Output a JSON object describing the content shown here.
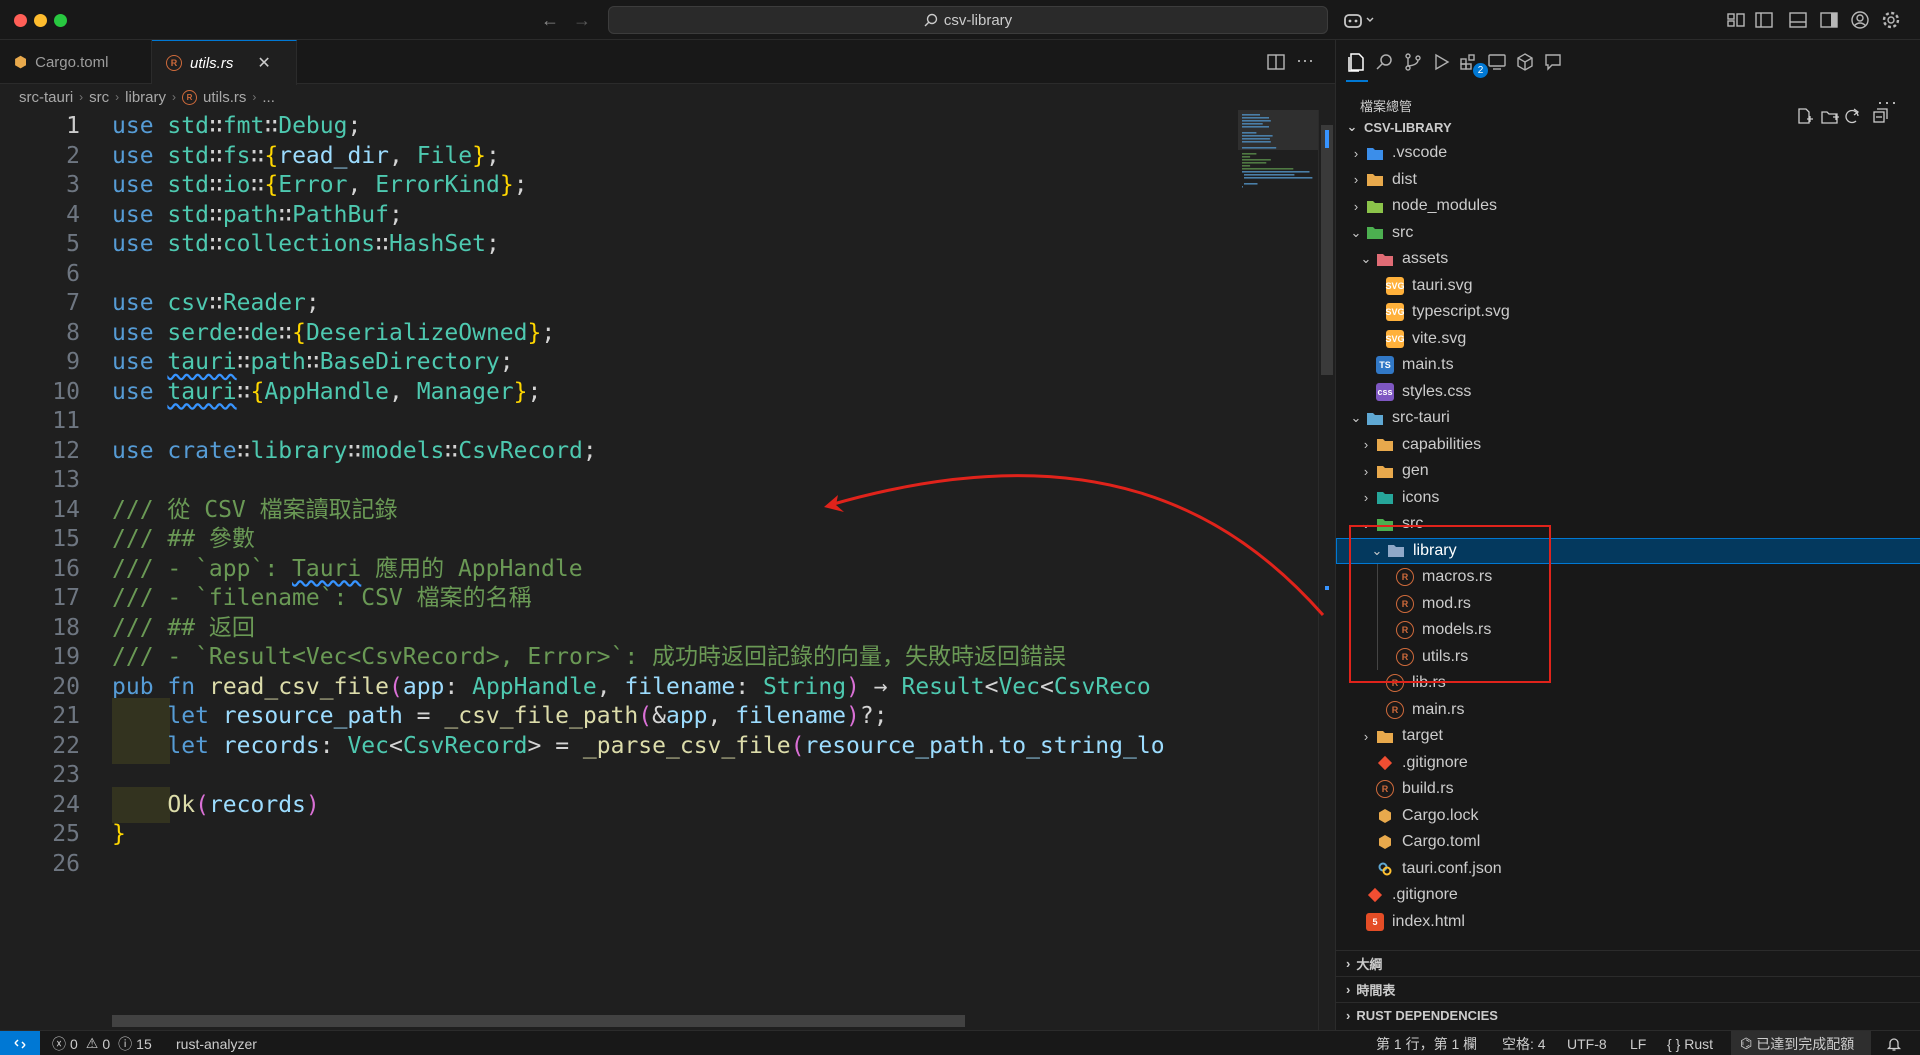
{
  "window": {
    "search_text": "csv-library"
  },
  "tabs": [
    {
      "label": "Cargo.toml",
      "icon": "rust-cargo-icon"
    },
    {
      "label": "utils.rs",
      "icon": "rust-file-icon",
      "active": true
    }
  ],
  "breadcrumb": [
    "src-tauri",
    "src",
    "library",
    "utils.rs",
    "..."
  ],
  "editor": {
    "current_line": "1",
    "line_numbers": [
      "1",
      "2",
      "3",
      "4",
      "5",
      "6",
      "7",
      "8",
      "9",
      "10",
      "11",
      "12",
      "13",
      "14",
      "15",
      "16",
      "17",
      "18",
      "19",
      "20",
      "21",
      "22",
      "23",
      "24",
      "25",
      "26"
    ],
    "lines": [
      "use std::fmt::Debug;",
      "use std::fs::{read_dir, File};",
      "use std::io::{Error, ErrorKind};",
      "use std::path::PathBuf;",
      "use std::collections::HashSet;",
      "",
      "use csv::Reader;",
      "use serde::de::{DeserializeOwned};",
      "use tauri::path::BaseDirectory;",
      "use tauri::{AppHandle, Manager};",
      "",
      "use crate::library::models::CsvRecord;",
      "",
      "/// 從 CSV 檔案讀取記錄",
      "/// ## 參數",
      "/// - `app`: Tauri 應用的 AppHandle",
      "/// - `filename`: CSV 檔案的名稱",
      "/// ## 返回",
      "/// - `Result<Vec<CsvRecord>, Error>`: 成功時返回記錄的向量，失敗時返回錯誤",
      "pub fn read_csv_file(app: AppHandle, filename: String) → Result<Vec<CsvReco",
      "    let resource_path = _csv_file_path(&app, filename)?;",
      "    let records: Vec<CsvRecord> = _parse_csv_file(resource_path.to_string_lo",
      "",
      "    Ok(records)",
      "}",
      ""
    ]
  },
  "explorer": {
    "title": "檔案總管",
    "more": "···",
    "root": "CSV-LIBRARY",
    "tree": [
      {
        "label": ".vscode",
        "depth": 1,
        "chev": "›",
        "icon": "vscode-folder-icon",
        "color": "#3b8eea"
      },
      {
        "label": "dist",
        "depth": 1,
        "chev": "›",
        "icon": "folder-icon",
        "color": "#e8a94c"
      },
      {
        "label": "node_modules",
        "depth": 1,
        "chev": "›",
        "icon": "node-folder-icon",
        "color": "#8bc34a"
      },
      {
        "label": "src",
        "depth": 1,
        "chev": "⌄",
        "icon": "src-folder-icon",
        "color": "#4caf50"
      },
      {
        "label": "assets",
        "depth": 2,
        "chev": "⌄",
        "icon": "assets-folder-icon",
        "color": "#e06c75"
      },
      {
        "label": "tauri.svg",
        "depth": 3,
        "chev": "",
        "icon": "svg-file-icon",
        "color": "#ffb13b",
        "badge": "SVG"
      },
      {
        "label": "typescript.svg",
        "depth": 3,
        "chev": "",
        "icon": "svg-file-icon",
        "color": "#ffb13b",
        "badge": "SVG"
      },
      {
        "label": "vite.svg",
        "depth": 3,
        "chev": "",
        "icon": "svg-file-icon",
        "color": "#ffb13b",
        "badge": "SVG"
      },
      {
        "label": "main.ts",
        "depth": 2,
        "chev": "",
        "icon": "typescript-file-icon",
        "color": "#3178c6",
        "badge": "TS"
      },
      {
        "label": "styles.css",
        "depth": 2,
        "chev": "",
        "icon": "css-file-icon",
        "color": "#7e57c2",
        "badge": "css"
      },
      {
        "label": "src-tauri",
        "depth": 1,
        "chev": "⌄",
        "icon": "tauri-folder-icon",
        "color": "#5fa8d3"
      },
      {
        "label": "capabilities",
        "depth": 2,
        "chev": "›",
        "icon": "folder-icon",
        "color": "#e8a94c"
      },
      {
        "label": "gen",
        "depth": 2,
        "chev": "›",
        "icon": "folder-icon",
        "color": "#e8a94c"
      },
      {
        "label": "icons",
        "depth": 2,
        "chev": "›",
        "icon": "images-folder-icon",
        "color": "#26a69a"
      },
      {
        "label": "src",
        "depth": 2,
        "chev": "⌄",
        "icon": "src-folder-icon",
        "color": "#4caf50"
      },
      {
        "label": "library",
        "depth": 3,
        "chev": "⌄",
        "icon": "library-folder-icon",
        "color": "#8fa8c8",
        "selected": true
      },
      {
        "label": "macros.rs",
        "depth": 4,
        "chev": "",
        "icon": "rust-file-icon",
        "color": "#ce6a3b",
        "badge": "R"
      },
      {
        "label": "mod.rs",
        "depth": 4,
        "chev": "",
        "icon": "rust-file-icon",
        "color": "#ce6a3b",
        "badge": "R"
      },
      {
        "label": "models.rs",
        "depth": 4,
        "chev": "",
        "icon": "rust-file-icon",
        "color": "#ce6a3b",
        "badge": "R"
      },
      {
        "label": "utils.rs",
        "depth": 4,
        "chev": "",
        "icon": "rust-file-icon",
        "color": "#ce6a3b",
        "badge": "R"
      },
      {
        "label": "lib.rs",
        "depth": 3,
        "chev": "",
        "icon": "rust-file-icon",
        "color": "#ce6a3b",
        "badge": "R"
      },
      {
        "label": "main.rs",
        "depth": 3,
        "chev": "",
        "icon": "rust-file-icon",
        "color": "#ce6a3b",
        "badge": "R"
      },
      {
        "label": "target",
        "depth": 2,
        "chev": "›",
        "icon": "folder-icon",
        "color": "#e8a94c"
      },
      {
        "label": ".gitignore",
        "depth": 2,
        "chev": "",
        "icon": "git-file-icon",
        "color": "#f14e32"
      },
      {
        "label": "build.rs",
        "depth": 2,
        "chev": "",
        "icon": "rust-file-icon",
        "color": "#ce6a3b",
        "badge": "R"
      },
      {
        "label": "Cargo.lock",
        "depth": 2,
        "chev": "",
        "icon": "cargo-file-icon",
        "color": "#e8a94c"
      },
      {
        "label": "Cargo.toml",
        "depth": 2,
        "chev": "",
        "icon": "cargo-file-icon",
        "color": "#e8a94c"
      },
      {
        "label": "tauri.conf.json",
        "depth": 2,
        "chev": "",
        "icon": "tauri-config-icon",
        "color": "#5fa8d3"
      },
      {
        "label": ".gitignore",
        "depth": 1,
        "chev": "",
        "icon": "git-file-icon",
        "color": "#f14e32"
      },
      {
        "label": "index.html",
        "depth": 1,
        "chev": "",
        "icon": "html-file-icon",
        "color": "#e44d26",
        "badge": "5"
      }
    ],
    "sections": [
      "大綱",
      "時間表",
      "RUST DEPENDENCIES"
    ]
  },
  "status": {
    "errors": "0",
    "warnings": "0",
    "infos": "15",
    "extension": "rust-analyzer",
    "position": "第 1 行，第 1 欄",
    "indent": "空格: 4",
    "encoding": "UTF-8",
    "eol": "LF",
    "language_braces": "{ }",
    "language": "Rust",
    "copilot": "已達到完成配額"
  },
  "activity_badge": "2",
  "colors": {
    "accent": "#0078d4",
    "annotation": "#e0231b",
    "selection": "#04395e"
  }
}
